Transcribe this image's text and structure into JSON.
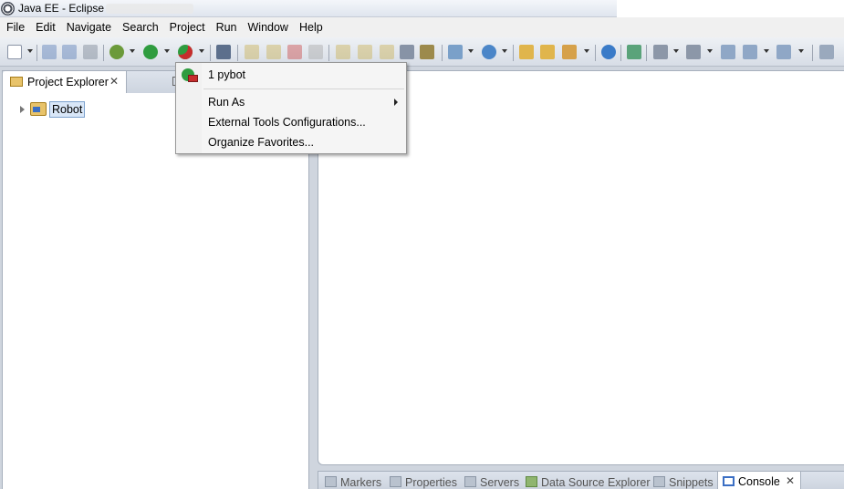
{
  "window": {
    "title": "Java EE - Eclipse"
  },
  "menubar": {
    "items": [
      "File",
      "Edit",
      "Navigate",
      "Search",
      "Project",
      "Run",
      "Window",
      "Help"
    ]
  },
  "toolbar": {
    "icons": [
      "new-icon",
      "save-icon",
      "save-all-icon",
      "print-icon",
      "debug-icon",
      "run-icon",
      "external-tools-icon",
      "skip-breakpoints-icon",
      "resume-icon",
      "suspend-icon",
      "terminate-icon",
      "disconnect-icon",
      "step-into-icon",
      "step-over-icon",
      "step-return-icon",
      "use-step-filters-icon",
      "new-server-icon",
      "new-web-service-icon",
      "open-type-icon",
      "open-task-icon",
      "search-icon",
      "web-browser-icon",
      "next-annotation-icon",
      "prev-annotation-icon",
      "back-icon",
      "forward-icon",
      "open-perspective-icon"
    ]
  },
  "left_panel": {
    "tab_label": "Project Explorer",
    "tree": [
      {
        "label": "Robot"
      }
    ]
  },
  "external_tools_menu": {
    "recent": "1 pybot",
    "items": [
      "Run As",
      "External Tools Configurations...",
      "Organize Favorites..."
    ]
  },
  "bottom_panel": {
    "tabs": [
      "Markers",
      "Properties",
      "Servers",
      "Data Source Explorer",
      "Snippets",
      "Console"
    ],
    "active": "Console"
  }
}
